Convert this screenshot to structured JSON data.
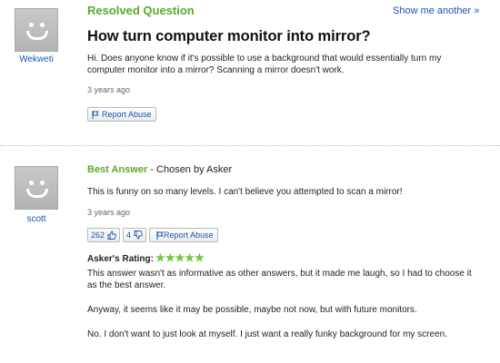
{
  "question": {
    "status": "Resolved Question",
    "show_another": "Show me another »",
    "title": "How turn computer monitor into mirror?",
    "body": "Hi. Does anyone know if it's possible to use a background that would essentially turn my computer monitor into a mirror? Scanning a mirror doesn't work.",
    "time": "3 years ago",
    "report": "Report Abuse",
    "asker": "Wekweti"
  },
  "answer": {
    "label": "Best Answer",
    "chosen": " - Chosen by Asker",
    "text": "This is funny on so many levels. I can't believe you attempted to scan a mirror!",
    "time": "3 years ago",
    "thumbs_up": "262",
    "thumbs_down": "4",
    "report": "Report Abuse",
    "answerer": "scott",
    "rating_label": "Asker's Rating:",
    "rating_stars": 5,
    "rating_glyphs": "★★★★★",
    "comment_1": "This answer wasn't as informative as other answers, but it made me laugh, so I had to choose it as the best answer.",
    "comment_2": "Anyway, it seems like it may be possible, maybe not now, but with future monitors.",
    "comment_3": "No. I don't want to just look at myself. I just want a really funky background for my screen."
  },
  "colors": {
    "green": "#5aa92a",
    "link": "#1a55b5",
    "star": "#6cc83c"
  }
}
